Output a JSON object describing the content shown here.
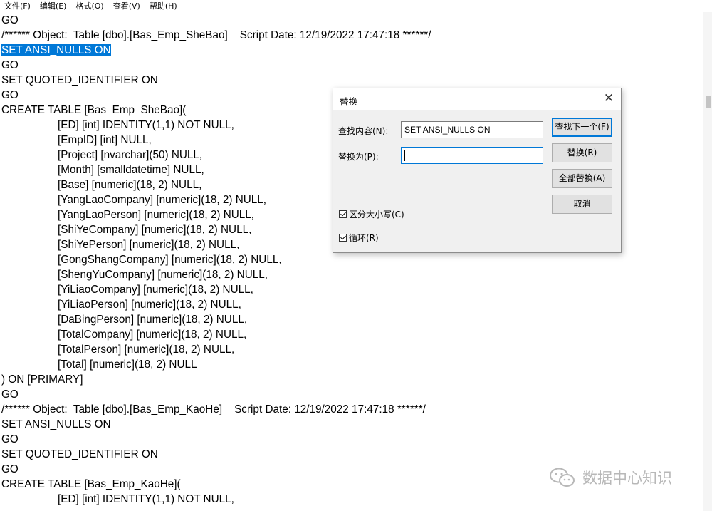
{
  "menu": [
    "文件(F)",
    "编辑(E)",
    "格式(O)",
    "查看(V)",
    "帮助(H)"
  ],
  "editor": {
    "lines": [
      "GO",
      "/****** Object:  Table [dbo].[Bas_Emp_SheBao]    Script Date: 12/19/2022 17:47:18 ******/",
      "SET ANSI_NULLS ON",
      "GO",
      "SET QUOTED_IDENTIFIER ON",
      "GO",
      "CREATE TABLE [Bas_Emp_SheBao](",
      "[ED] [int] IDENTITY(1,1) NOT NULL,",
      "[EmpID] [int] NULL,",
      "[Project] [nvarchar](50) NULL,",
      "[Month] [smalldatetime] NULL,",
      "[Base] [numeric](18, 2) NULL,",
      "[YangLaoCompany] [numeric](18, 2) NULL,",
      "[YangLaoPerson] [numeric](18, 2) NULL,",
      "[ShiYeCompany] [numeric](18, 2) NULL,",
      "[ShiYePerson] [numeric](18, 2) NULL,",
      "[GongShangCompany] [numeric](18, 2) NULL,",
      "[ShengYuCompany] [numeric](18, 2) NULL,",
      "[YiLiaoCompany] [numeric](18, 2) NULL,",
      "[YiLiaoPerson] [numeric](18, 2) NULL,",
      "[DaBingPerson] [numeric](18, 2) NULL,",
      "[TotalCompany] [numeric](18, 2) NULL,",
      "[TotalPerson] [numeric](18, 2) NULL,",
      "[Total] [numeric](18, 2) NULL",
      ") ON [PRIMARY]",
      "GO",
      "/****** Object:  Table [dbo].[Bas_Emp_KaoHe]    Script Date: 12/19/2022 17:47:18 ******/",
      "SET ANSI_NULLS ON",
      "GO",
      "SET QUOTED_IDENTIFIER ON",
      "GO",
      "CREATE TABLE [Bas_Emp_KaoHe](",
      "[ED] [int] IDENTITY(1,1) NOT NULL,"
    ],
    "indented_lines": [
      7,
      8,
      9,
      10,
      11,
      12,
      13,
      14,
      15,
      16,
      17,
      18,
      19,
      20,
      21,
      22,
      23,
      32
    ],
    "selected_line": 2
  },
  "dialog": {
    "title": "替换",
    "find_label": "查找内容(N):",
    "find_value": "SET ANSI_NULLS ON",
    "replace_label": "替换为(P):",
    "replace_value": "",
    "find_next_button": "查找下一个(F)",
    "replace_button": "替换(R)",
    "replace_all_button": "全部替换(A)",
    "cancel_button": "取消",
    "match_case_label": "区分大小写(C)",
    "match_case_checked": true,
    "wrap_label": "循环(R)",
    "wrap_checked": true
  },
  "watermark": {
    "text": "数据中心知识",
    "icon": "wechat-icon"
  },
  "colors": {
    "selection": "#0078d7",
    "watermark": "#b8b8b8"
  }
}
